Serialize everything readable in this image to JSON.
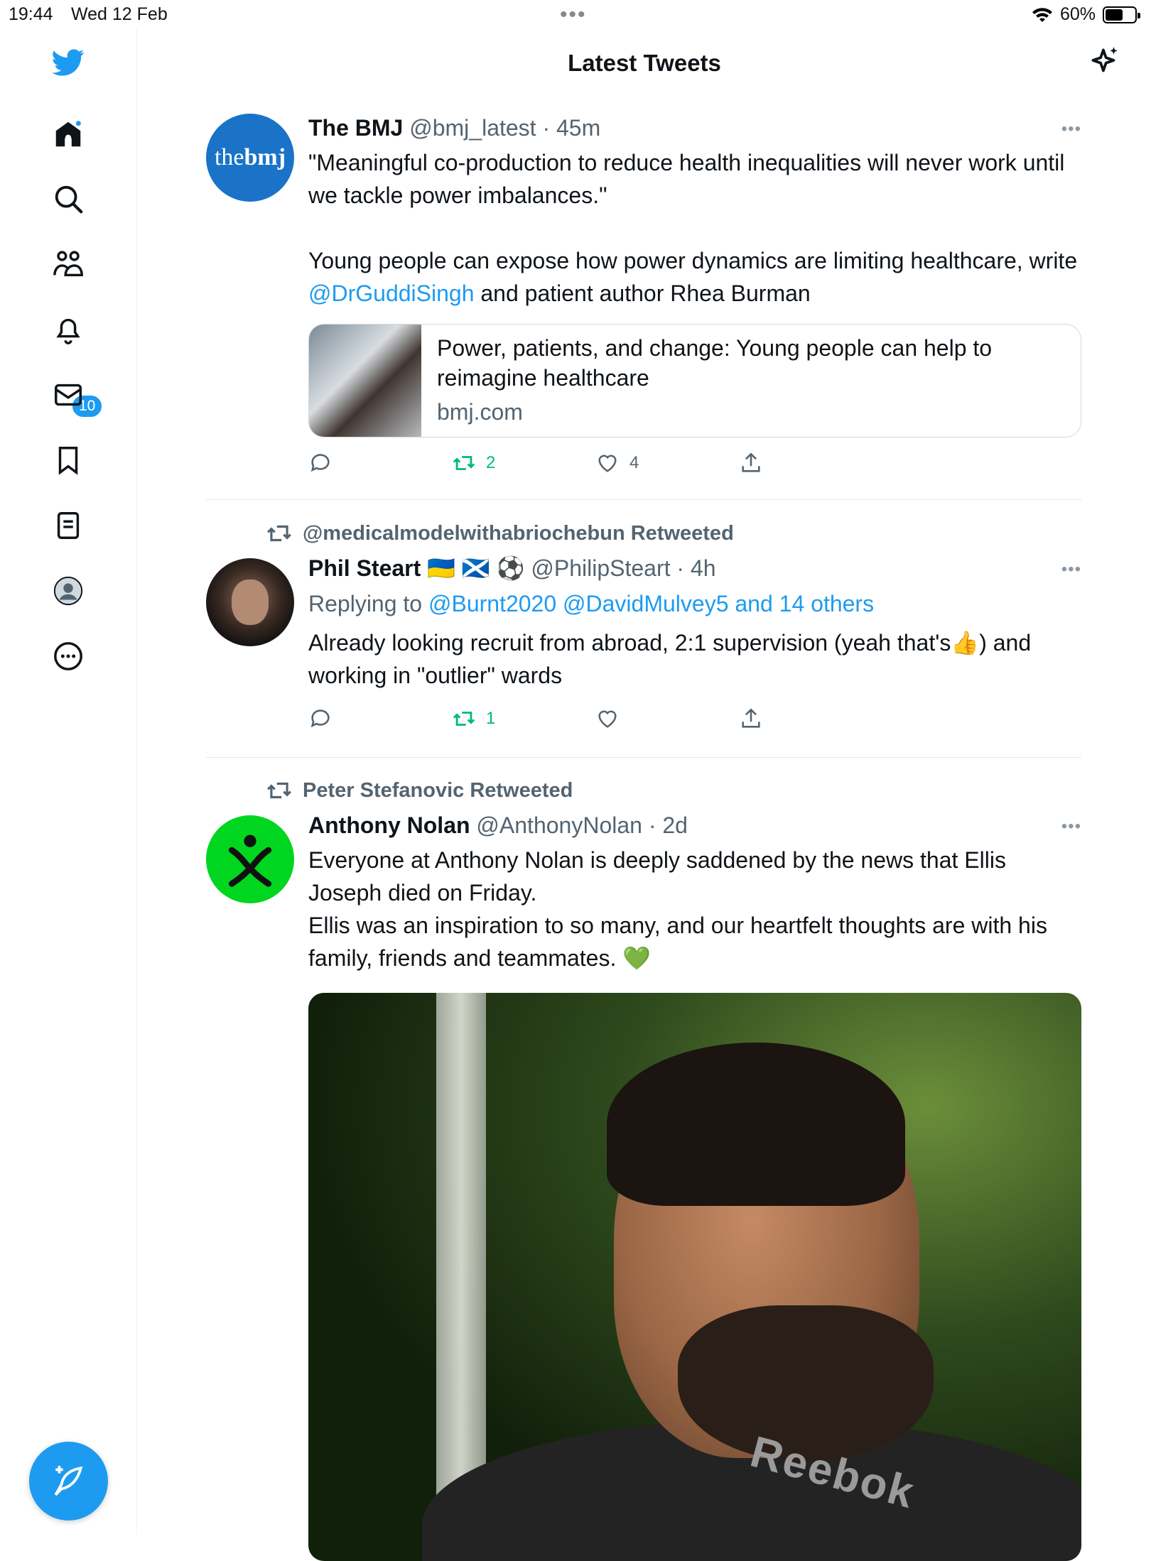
{
  "status_bar": {
    "time": "19:44",
    "date": "Wed 12 Feb",
    "battery": "60%",
    "battery_level": 0.6,
    "dots": "•••"
  },
  "header": {
    "title": "Latest Tweets"
  },
  "sidebar": {
    "items": [
      "twitter-logo",
      "home",
      "search",
      "communities",
      "notifications",
      "messages",
      "bookmarks",
      "lists",
      "profile",
      "more"
    ],
    "notifications_badge": "10"
  },
  "tweets": [
    {
      "name": "The BMJ",
      "handle": "@bmj_latest",
      "time": "· 45m",
      "avatar_text": {
        "a": "the",
        "b": "bmj"
      },
      "text_1": "\"Meaningful co-production to reduce health inequalities will never work until we tackle power imbalances.\"",
      "text_2a": "Young people can expose how power dynamics are limiting healthcare, write ",
      "mention": "@DrGuddiSingh",
      "text_2b": " and patient author Rhea Burman",
      "card": {
        "title": "Power, patients, and change: Young people can help to reimagine healthcare",
        "domain": "bmj.com"
      },
      "retweets": "2",
      "likes": "4"
    },
    {
      "retweeted_by": "@medicalmodelwithabriochebun Retweeted",
      "name": "Phil Steart",
      "flags": "🇺🇦 🏴󠁧󠁢󠁳󠁣󠁴󠁿 ⚽",
      "handle": "@PhilipSteart",
      "time": "· 4h",
      "replying_label": "Replying to ",
      "replying_to": "@Burnt2020 @DavidMulvey5 and 14 others",
      "text": "Already looking recruit from abroad, 2:1 supervision (yeah that's👍) and working in \"outlier\" wards",
      "retweets": "1"
    },
    {
      "retweeted_by": "Peter Stefanovic Retweeted",
      "name": "Anthony Nolan",
      "handle": "@AnthonyNolan",
      "time": "· 2d",
      "text_1": "Everyone at Anthony Nolan is deeply saddened by the news that Ellis Joseph died on Friday.",
      "text_2": "Ellis was an inspiration to so many, and our heartfelt thoughts are with his family, friends and teammates. 💚",
      "media_shirt_text": "Reebok"
    }
  ],
  "colors": {
    "accent": "#1d9bf0",
    "retweet": "#00ba7c",
    "secondary": "#536471",
    "anthony_nolan_green": "#00d61f"
  }
}
